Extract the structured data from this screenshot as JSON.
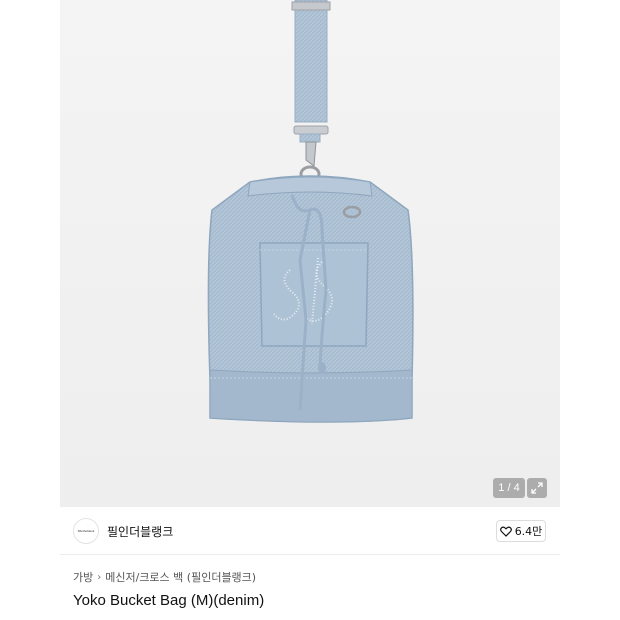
{
  "gallery": {
    "image_alt": "",
    "counter": "1 / 4",
    "current_index": 1,
    "total_images": 4,
    "colors": {
      "denim": "#a9bdd1",
      "denim_dark": "#8ea6be",
      "hardware": "#b9bcc0"
    }
  },
  "brand": {
    "name": "필인더블랭크",
    "logo_text": "fillintheblank"
  },
  "likes": {
    "icon": "heart-icon",
    "count": "6.4만"
  },
  "breadcrumb": {
    "items": [
      "가방",
      "메신저/크로스 백 (필인더블랭크)"
    ],
    "separator": "›"
  },
  "product": {
    "title": "Yoko Bucket Bag (M)(denim)"
  }
}
